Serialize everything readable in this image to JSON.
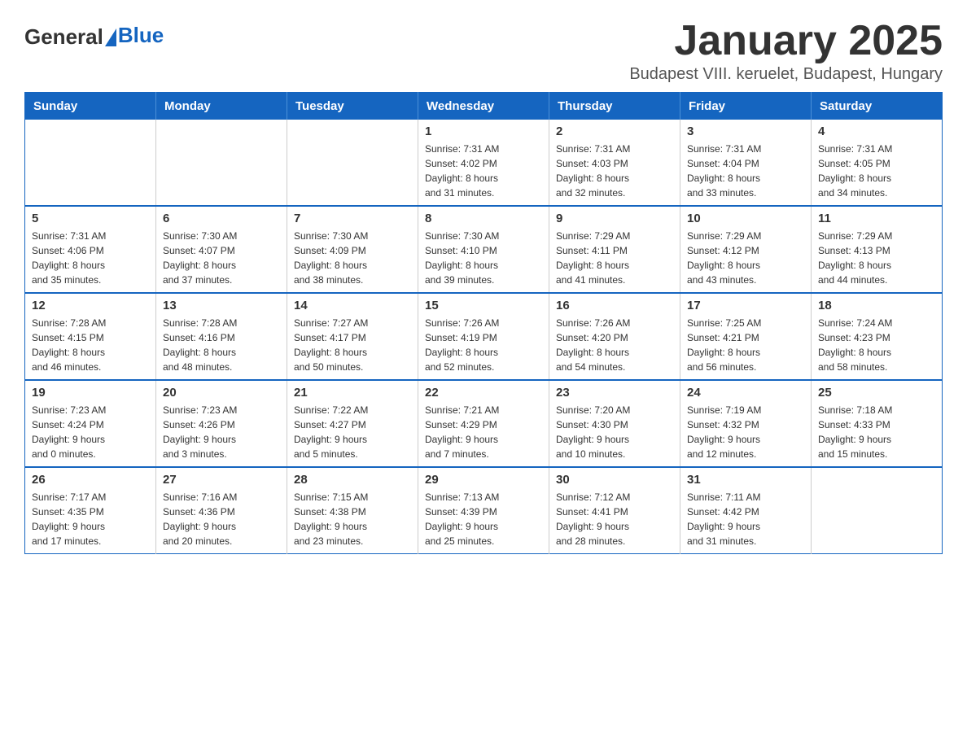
{
  "header": {
    "logo_general": "General",
    "logo_blue": "Blue",
    "month_title": "January 2025",
    "location": "Budapest VIII. keruelet, Budapest, Hungary"
  },
  "weekdays": [
    "Sunday",
    "Monday",
    "Tuesday",
    "Wednesday",
    "Thursday",
    "Friday",
    "Saturday"
  ],
  "weeks": [
    [
      {
        "day": "",
        "info": ""
      },
      {
        "day": "",
        "info": ""
      },
      {
        "day": "",
        "info": ""
      },
      {
        "day": "1",
        "info": "Sunrise: 7:31 AM\nSunset: 4:02 PM\nDaylight: 8 hours\nand 31 minutes."
      },
      {
        "day": "2",
        "info": "Sunrise: 7:31 AM\nSunset: 4:03 PM\nDaylight: 8 hours\nand 32 minutes."
      },
      {
        "day": "3",
        "info": "Sunrise: 7:31 AM\nSunset: 4:04 PM\nDaylight: 8 hours\nand 33 minutes."
      },
      {
        "day": "4",
        "info": "Sunrise: 7:31 AM\nSunset: 4:05 PM\nDaylight: 8 hours\nand 34 minutes."
      }
    ],
    [
      {
        "day": "5",
        "info": "Sunrise: 7:31 AM\nSunset: 4:06 PM\nDaylight: 8 hours\nand 35 minutes."
      },
      {
        "day": "6",
        "info": "Sunrise: 7:30 AM\nSunset: 4:07 PM\nDaylight: 8 hours\nand 37 minutes."
      },
      {
        "day": "7",
        "info": "Sunrise: 7:30 AM\nSunset: 4:09 PM\nDaylight: 8 hours\nand 38 minutes."
      },
      {
        "day": "8",
        "info": "Sunrise: 7:30 AM\nSunset: 4:10 PM\nDaylight: 8 hours\nand 39 minutes."
      },
      {
        "day": "9",
        "info": "Sunrise: 7:29 AM\nSunset: 4:11 PM\nDaylight: 8 hours\nand 41 minutes."
      },
      {
        "day": "10",
        "info": "Sunrise: 7:29 AM\nSunset: 4:12 PM\nDaylight: 8 hours\nand 43 minutes."
      },
      {
        "day": "11",
        "info": "Sunrise: 7:29 AM\nSunset: 4:13 PM\nDaylight: 8 hours\nand 44 minutes."
      }
    ],
    [
      {
        "day": "12",
        "info": "Sunrise: 7:28 AM\nSunset: 4:15 PM\nDaylight: 8 hours\nand 46 minutes."
      },
      {
        "day": "13",
        "info": "Sunrise: 7:28 AM\nSunset: 4:16 PM\nDaylight: 8 hours\nand 48 minutes."
      },
      {
        "day": "14",
        "info": "Sunrise: 7:27 AM\nSunset: 4:17 PM\nDaylight: 8 hours\nand 50 minutes."
      },
      {
        "day": "15",
        "info": "Sunrise: 7:26 AM\nSunset: 4:19 PM\nDaylight: 8 hours\nand 52 minutes."
      },
      {
        "day": "16",
        "info": "Sunrise: 7:26 AM\nSunset: 4:20 PM\nDaylight: 8 hours\nand 54 minutes."
      },
      {
        "day": "17",
        "info": "Sunrise: 7:25 AM\nSunset: 4:21 PM\nDaylight: 8 hours\nand 56 minutes."
      },
      {
        "day": "18",
        "info": "Sunrise: 7:24 AM\nSunset: 4:23 PM\nDaylight: 8 hours\nand 58 minutes."
      }
    ],
    [
      {
        "day": "19",
        "info": "Sunrise: 7:23 AM\nSunset: 4:24 PM\nDaylight: 9 hours\nand 0 minutes."
      },
      {
        "day": "20",
        "info": "Sunrise: 7:23 AM\nSunset: 4:26 PM\nDaylight: 9 hours\nand 3 minutes."
      },
      {
        "day": "21",
        "info": "Sunrise: 7:22 AM\nSunset: 4:27 PM\nDaylight: 9 hours\nand 5 minutes."
      },
      {
        "day": "22",
        "info": "Sunrise: 7:21 AM\nSunset: 4:29 PM\nDaylight: 9 hours\nand 7 minutes."
      },
      {
        "day": "23",
        "info": "Sunrise: 7:20 AM\nSunset: 4:30 PM\nDaylight: 9 hours\nand 10 minutes."
      },
      {
        "day": "24",
        "info": "Sunrise: 7:19 AM\nSunset: 4:32 PM\nDaylight: 9 hours\nand 12 minutes."
      },
      {
        "day": "25",
        "info": "Sunrise: 7:18 AM\nSunset: 4:33 PM\nDaylight: 9 hours\nand 15 minutes."
      }
    ],
    [
      {
        "day": "26",
        "info": "Sunrise: 7:17 AM\nSunset: 4:35 PM\nDaylight: 9 hours\nand 17 minutes."
      },
      {
        "day": "27",
        "info": "Sunrise: 7:16 AM\nSunset: 4:36 PM\nDaylight: 9 hours\nand 20 minutes."
      },
      {
        "day": "28",
        "info": "Sunrise: 7:15 AM\nSunset: 4:38 PM\nDaylight: 9 hours\nand 23 minutes."
      },
      {
        "day": "29",
        "info": "Sunrise: 7:13 AM\nSunset: 4:39 PM\nDaylight: 9 hours\nand 25 minutes."
      },
      {
        "day": "30",
        "info": "Sunrise: 7:12 AM\nSunset: 4:41 PM\nDaylight: 9 hours\nand 28 minutes."
      },
      {
        "day": "31",
        "info": "Sunrise: 7:11 AM\nSunset: 4:42 PM\nDaylight: 9 hours\nand 31 minutes."
      },
      {
        "day": "",
        "info": ""
      }
    ]
  ]
}
